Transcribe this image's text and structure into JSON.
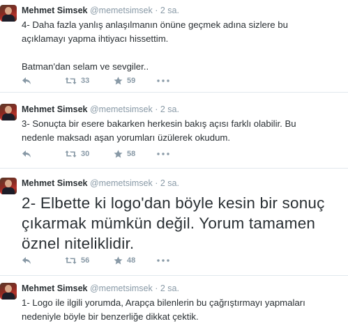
{
  "tweets": [
    {
      "author_name": "Mehmet Simsek",
      "handle": "@memetsimsek",
      "time": "· 2 sa.",
      "lines": [
        "4- Daha fazla yanlış anlaşılmanın önüne geçmek adına sizlere bu",
        "açıklamayı yapma ihtiyacı hissettim.",
        "",
        "Batman'dan selam ve sevgiler.."
      ],
      "retweets": "33",
      "favorites": "59"
    },
    {
      "author_name": "Mehmet Simsek",
      "handle": "@memetsimsek",
      "time": "· 2 sa.",
      "lines": [
        "3- Sonuçta bir esere bakarken herkesin bakış açısı farklı olabilir. Bu",
        "nedenle maksadı aşan yorumları üzülerek okudum."
      ],
      "retweets": "30",
      "favorites": "58"
    },
    {
      "author_name": "Mehmet Simsek",
      "handle": "@memetsimsek",
      "time": "· 2 sa.",
      "lines": [
        "2- Elbette ki logo'dan böyle kesin bir sonuç",
        "çıkarmak mümkün değil. Yorum tamamen",
        "öznel niteliklidir."
      ],
      "retweets": "56",
      "favorites": "48"
    },
    {
      "author_name": "Mehmet Simsek",
      "handle": "@memetsimsek",
      "time": "· 2 sa.",
      "lines": [
        "1- Logo ile ilgili yorumda, Arapça bilenlerin bu çağrıştırmayı yapmaları",
        "nedeniyle böyle bir benzerliğe dikkat çektik."
      ]
    }
  ],
  "icons": {
    "reply": "reply-icon",
    "retweet": "retweet-icon",
    "favorite": "star-icon",
    "more": "more-dots-icon"
  },
  "colors": {
    "text": "#292f33",
    "muted": "#8899a6",
    "divider": "#e1e8ed"
  }
}
